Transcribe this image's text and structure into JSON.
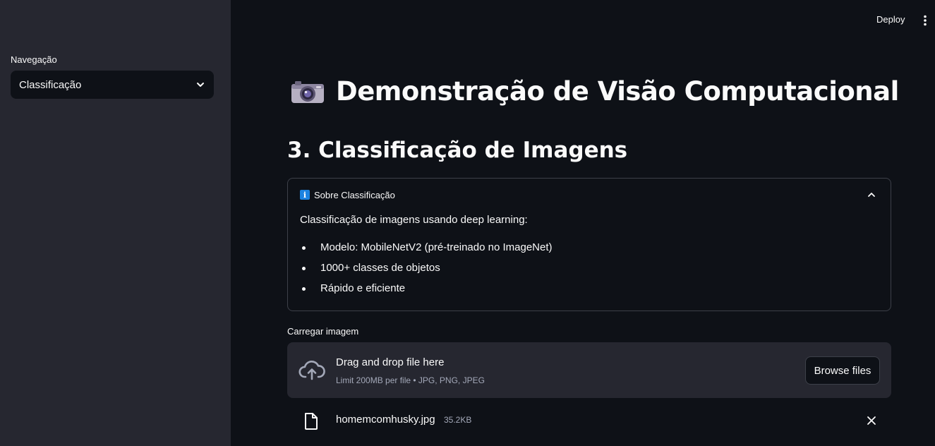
{
  "sidebar": {
    "nav_label": "Navegação",
    "nav_select_value": "Classificação"
  },
  "header": {
    "deploy_label": "Deploy",
    "menu_icon": "more-vertical-icon"
  },
  "main": {
    "title": "Demonstração de Visão Computacional",
    "title_icon": "camera-icon",
    "section_title": "3. Classificação de Imagens",
    "expander": {
      "icon": "info-icon",
      "title": "Sobre Classificação",
      "intro": "Classificação de imagens usando deep learning:",
      "items": [
        "Modelo: MobileNetV2 (pré-treinado no ImageNet)",
        "1000+ classes de objetos",
        "Rápido e eficiente"
      ]
    },
    "uploader": {
      "label": "Carregar imagem",
      "dropzone_title": "Drag and drop file here",
      "dropzone_subtitle": "Limit 200MB per file • JPG, PNG, JPEG",
      "browse_label": "Browse files",
      "file": {
        "name": "homemcomhusky.jpg",
        "size": "35.2KB"
      }
    }
  },
  "colors": {
    "background": "#0e1117",
    "sidebar": "#262730",
    "text": "#fafafa",
    "muted": "#a3a8b8",
    "border": "#3d4049",
    "info": "#1c83e1"
  }
}
